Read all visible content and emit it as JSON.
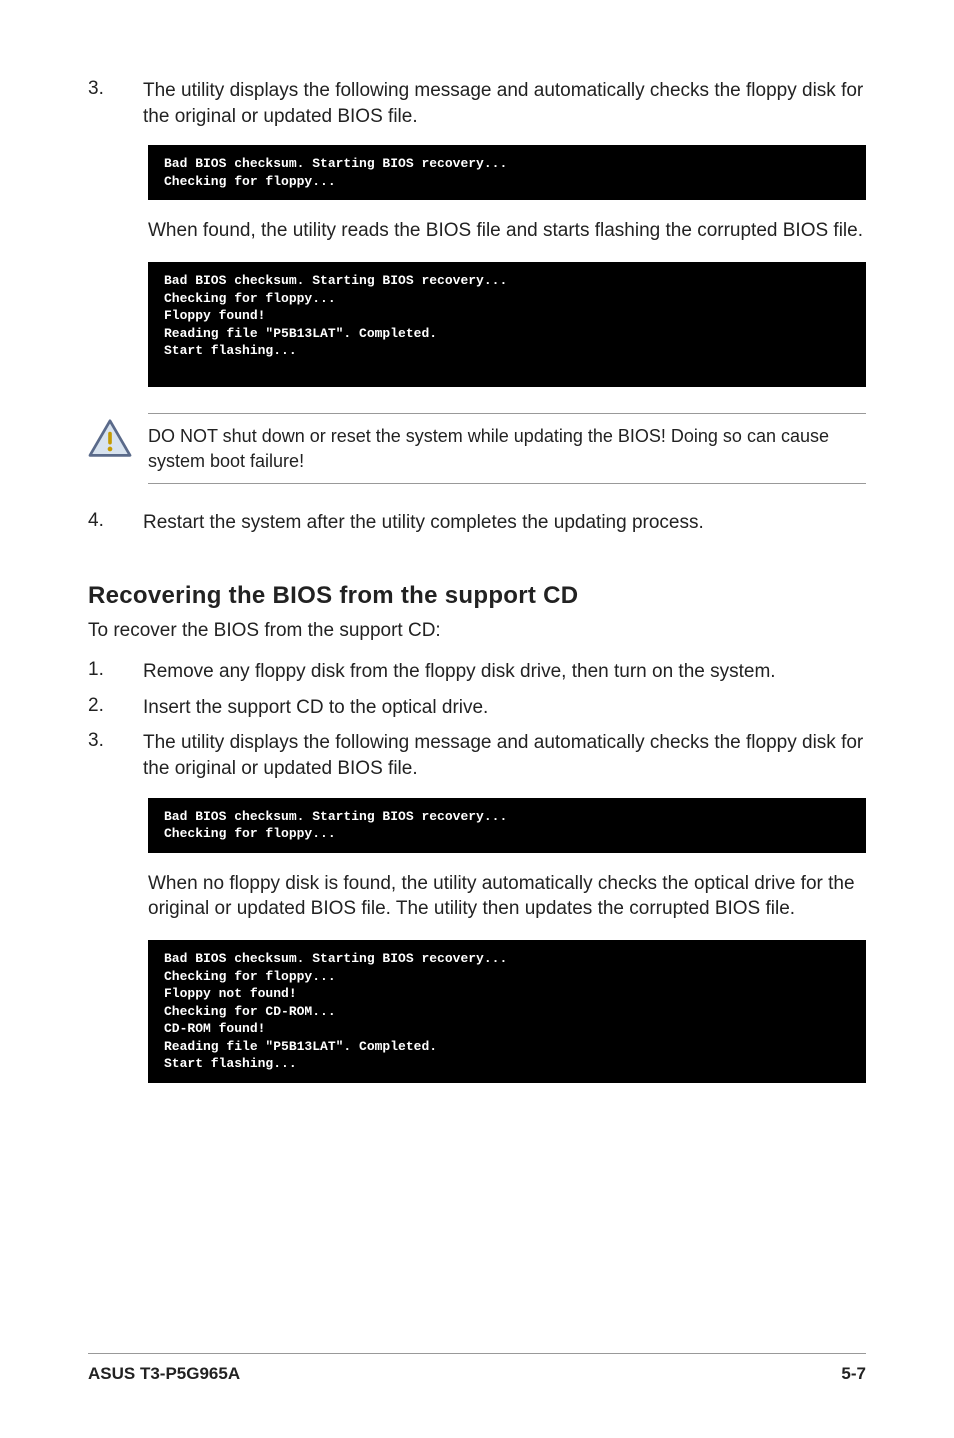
{
  "steps_top": {
    "s3_num": "3.",
    "s3_text": "The utility displays the following message and automatically checks the floppy disk for the original or updated BIOS file.",
    "s4_num": "4.",
    "s4_text": "Restart the system after the utility completes the updating process."
  },
  "terminal1": "Bad BIOS checksum. Starting BIOS recovery...\nChecking for floppy...",
  "indent_para1": "When found, the utility reads the BIOS file and starts flashing the corrupted BIOS file.",
  "terminal2": "Bad BIOS checksum. Starting BIOS recovery...\nChecking for floppy...\nFloppy found!\nReading file \"P5B13LAT\". Completed.\nStart flashing...\n\n",
  "callout_text": "DO NOT shut down or reset the system while updating the BIOS! Doing so can cause system boot failure!",
  "section_title": "Recovering the BIOS from the support CD",
  "section_intro": "To recover the BIOS from the support CD:",
  "steps_cd": {
    "s1_num": "1.",
    "s1_text": "Remove any floppy disk from the floppy disk drive, then turn on the system.",
    "s2_num": "2.",
    "s2_text": "Insert the support CD to the optical drive.",
    "s3_num": "3.",
    "s3_text": "The utility displays the following message and automatically checks the floppy disk for the original or updated BIOS file."
  },
  "terminal3": "Bad BIOS checksum. Starting BIOS recovery...\nChecking for floppy...",
  "indent_para2": "When no floppy disk is found, the utility automatically checks the optical drive for the original or updated BIOS file. The utility then updates the corrupted BIOS file.",
  "terminal4": "Bad BIOS checksum. Starting BIOS recovery...\nChecking for floppy...\nFloppy not found!\nChecking for CD-ROM...\nCD-ROM found!\nReading file \"P5B13LAT\". Completed.\nStart flashing...",
  "footer_left": "ASUS T3-P5G965A",
  "footer_right": "5-7"
}
